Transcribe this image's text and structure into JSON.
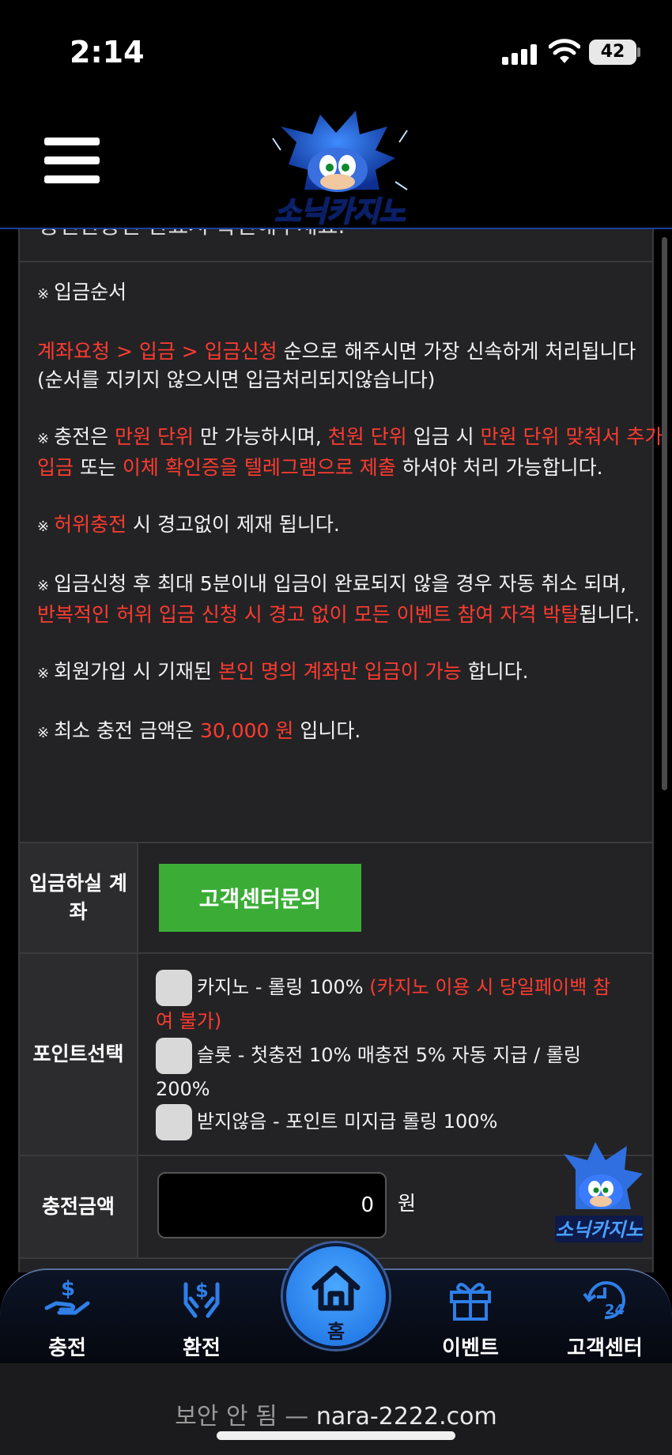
{
  "status_bar": {
    "time": "2:14",
    "battery": "42"
  },
  "header": {
    "logo_text": "소닉카지노"
  },
  "notice": {
    "cut_top_text": "승인완승인 완료시 확인해주세요.",
    "title": "입금순서",
    "p1": {
      "red": "계좌요청 > 입금 > 입금신청",
      "white": " 순으로 해주시면 가장 신속하게 처리됩니다",
      "line2": "(순서를 지키지 않으시면 입금처리되지않습니다)"
    },
    "p2": {
      "a": "충전은 ",
      "b": "만원 단위",
      "c": " 만 가능하시며, ",
      "d": "천원 단위",
      "e": " 입금 시 ",
      "f": "만원 단위 맞춰서 추가 입금",
      "g": " 또는 ",
      "h": "이체 확인증을 텔레그램으로 제출",
      "i": " 하셔야 처리 가능합니다."
    },
    "p3": {
      "red": "허위충전",
      "white": " 시 경고없이 제재 됩니다."
    },
    "p4": {
      "a": "입금신청 후 최대 5분이내 입금이 완료되지 않을 경우 자동 취소 되며,",
      "b": "반복적인 허위 입금 신청 시 경고 없이 모든 이벤트 참여 자격 박탈",
      "c": "됩니다."
    },
    "p5": {
      "a": "회원가입 시 기재된 ",
      "b": "본인 명의 계좌만 입금이 가능",
      "c": " 합니다."
    },
    "p6": {
      "a": "최소 충전 금액은 ",
      "b": "30,000 원",
      "c": " 입니다."
    },
    "mark": "※"
  },
  "form": {
    "account_label": "입금하실 계좌",
    "cs_button": "고객센터문의",
    "point_label": "포인트선택",
    "options": [
      {
        "text": "카지노 - 롤링 100% ",
        "red": "(카지노 이용 시 당일페이백 참여 불가)"
      },
      {
        "text": "슬롯 - 첫충전 10% 매충전 5% 자동 지급 / 롤링 200%",
        "red": ""
      },
      {
        "text": "받지않음 - 포인트 미지급 롤링 100%",
        "red": ""
      }
    ],
    "amount_label": "충전금액",
    "amount_value": "0",
    "amount_unit": "원"
  },
  "bottom_nav": {
    "items": [
      {
        "label": "충전",
        "icon": "deposit-icon"
      },
      {
        "label": "환전",
        "icon": "withdraw-icon"
      },
      {
        "label": "홈",
        "icon": "home-icon"
      },
      {
        "label": "이벤트",
        "icon": "gift-icon"
      },
      {
        "label": "고객센터",
        "icon": "support-24-icon"
      }
    ]
  },
  "browser": {
    "insecure": "보안 안 됨 — ",
    "domain": "nara-2222.com"
  },
  "colors": {
    "accent_red": "#ff3b30",
    "button_green": "#3bad37",
    "nav_blue": "#2f7fe8"
  }
}
